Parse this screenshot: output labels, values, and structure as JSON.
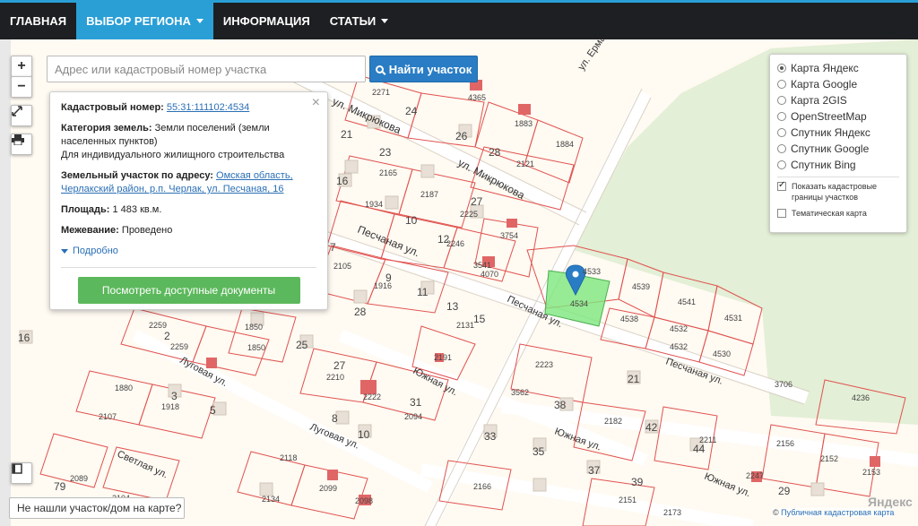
{
  "nav": {
    "items": [
      {
        "label": "ГЛАВНАЯ"
      },
      {
        "label": "ВЫБОР РЕГИОНА"
      },
      {
        "label": "ИНФОРМАЦИЯ"
      },
      {
        "label": "СТАТЬИ"
      }
    ]
  },
  "map_controls": {
    "zoom_in": "+",
    "zoom_out": "−"
  },
  "search": {
    "placeholder": "Адрес или кадастровый номер участка",
    "button": "Найти участок"
  },
  "popup": {
    "cadastral_label": "Кадастровый номер:",
    "cadastral_value": "55:31:111102:4534",
    "category_label": "Категория земель:",
    "category_value": "Земли поселений (земли населенных пунктов)",
    "category_use": "Для индивидуального жилищного строительства",
    "address_label": "Земельный участок по адресу:",
    "address_value": "Омская область, Черлакский район, р.п. Черлак, ул. Песчаная, 16",
    "area_label": "Площадь:",
    "area_value": "1 483 кв.м.",
    "survey_label": "Межевание:",
    "survey_value": "Проведено",
    "more": "Подробно",
    "docs_button": "Посмотреть доступные документы"
  },
  "layers": {
    "options": [
      {
        "label": "Карта Яндекс",
        "selected": true
      },
      {
        "label": "Карта Google",
        "selected": false
      },
      {
        "label": "Карта 2GIS",
        "selected": false
      },
      {
        "label": "OpenStreetMap",
        "selected": false
      },
      {
        "label": "Спутник Яндекс",
        "selected": false
      },
      {
        "label": "Спутник Google",
        "selected": false
      },
      {
        "label": "Спутник Bing",
        "selected": false
      }
    ],
    "show_cadastral": "Показать кадастровые границы участков",
    "thematic": "Тематическая карта"
  },
  "bottom_help": "Не нашли участок/дом на карте?",
  "attribution": {
    "prefix": "©",
    "link": "Публичная кадастровая карта"
  },
  "yandex_mark": "Яндекс",
  "map_labels": {
    "streets": [
      "ул. Микрюкова",
      "ул. Микрюкова",
      "Песчаная ул.",
      "Песчаная ул.",
      "Песчаная ул.",
      "Луговая ул.",
      "Луговая ул.",
      "Южная ул.",
      "Южная ул.",
      "Южная ул.",
      "Светлая ул.",
      "ул. Ермака"
    ],
    "parcels": [
      "2271",
      "24",
      "4365",
      "1883",
      "1884",
      "21",
      "26",
      "2121",
      "28",
      "2165",
      "23",
      "2187",
      "16",
      "1934",
      "10",
      "2225",
      "27",
      "3754",
      "2246",
      "12",
      "7",
      "3541",
      "4070",
      "2105",
      "9",
      "1916",
      "11",
      "13",
      "15",
      "28",
      "2131",
      "2259",
      "2",
      "2259",
      "1850",
      "1850",
      "16",
      "25",
      "2191",
      "27",
      "2210",
      "2222",
      "31",
      "2094",
      "1880",
      "3",
      "1918",
      "2107",
      "5",
      "8",
      "10",
      "4533",
      "4539",
      "4541",
      "4534",
      "4538",
      "4532",
      "4531",
      "4532",
      "4530",
      "2223",
      "21",
      "3562",
      "38",
      "2182",
      "42",
      "33",
      "35",
      "44",
      "2211",
      "37",
      "2118",
      "2099",
      "2134",
      "2098",
      "2166",
      "39",
      "2151",
      "2173",
      "2089",
      "79",
      "2104",
      "2156",
      "2152",
      "2153",
      "2247",
      "29",
      "3706",
      "4236"
    ]
  }
}
